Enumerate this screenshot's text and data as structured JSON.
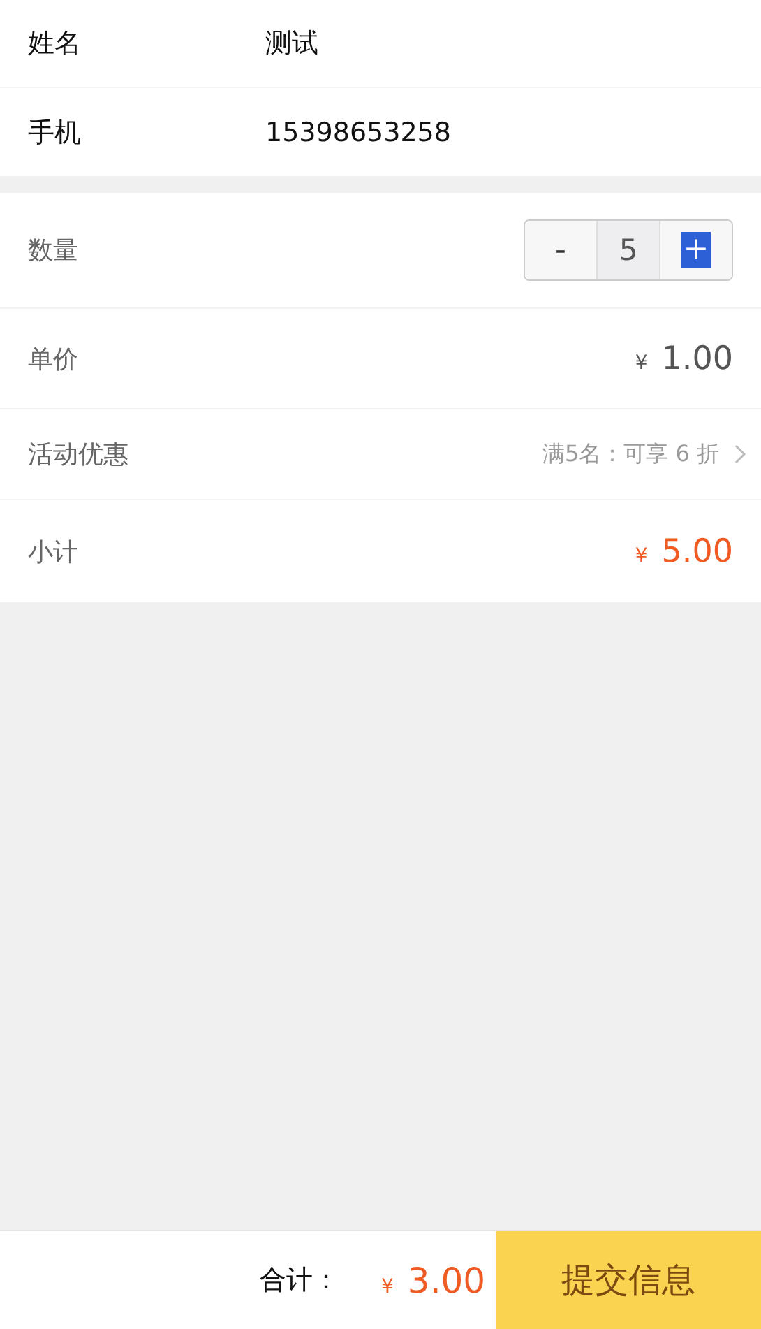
{
  "contact": [
    {
      "label": "姓名",
      "value": "测试"
    },
    {
      "label": "手机",
      "value": "15398653258"
    }
  ],
  "order": {
    "quantity": {
      "label": "数量",
      "minus": "-",
      "value": "5",
      "plus": "+",
      "plus_highlighted": true
    },
    "rows": [
      {
        "kind": "price",
        "label": "单价",
        "currency": "¥",
        "amount": "1.00",
        "accent": false
      },
      {
        "kind": "link",
        "label": "活动优惠",
        "value": "满5名：可享 6 折"
      },
      {
        "kind": "price",
        "label": "小计",
        "currency": "¥",
        "amount": "5.00",
        "accent": true
      }
    ]
  },
  "footer": {
    "total_label": "合计：",
    "currency": "¥",
    "amount": "3.00",
    "submit": "提交信息"
  }
}
